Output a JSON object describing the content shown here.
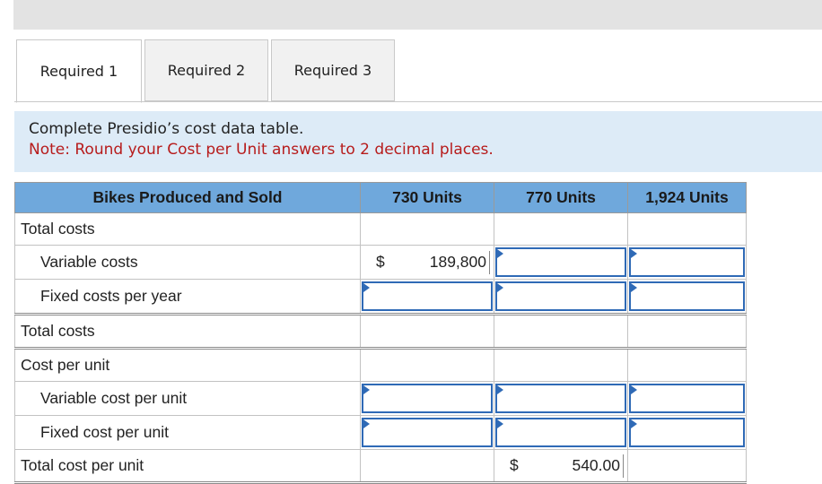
{
  "tabs": [
    {
      "label": "Required 1",
      "active": true
    },
    {
      "label": "Required 2",
      "active": false
    },
    {
      "label": "Required 3",
      "active": false
    }
  ],
  "instructions": {
    "line1": "Complete Presidio’s cost data table.",
    "line2": "Note: Round your Cost per Unit answers to 2 decimal places."
  },
  "table": {
    "headers": [
      "Bikes Produced and Sold",
      "730 Units",
      "770 Units",
      "1,924 Units"
    ],
    "rows": {
      "total_costs_header": "Total costs",
      "variable_costs": "Variable costs",
      "fixed_costs": "Fixed costs per year",
      "total_costs": "Total costs",
      "cost_per_unit_header": "Cost per unit",
      "variable_cost_per_unit": "Variable cost per unit",
      "fixed_cost_per_unit": "Fixed cost per unit",
      "total_cost_per_unit": "Total cost per unit"
    },
    "values": {
      "variable_costs_730_symbol": "$",
      "variable_costs_730": "189,800",
      "total_cost_per_unit_770_symbol": "$",
      "total_cost_per_unit_770": "540.00"
    }
  },
  "colors": {
    "header_bg": "#6fa8dc",
    "note_bg": "#ddebf7",
    "note_red": "#b71c1c",
    "input_border": "#2f6ab6"
  }
}
